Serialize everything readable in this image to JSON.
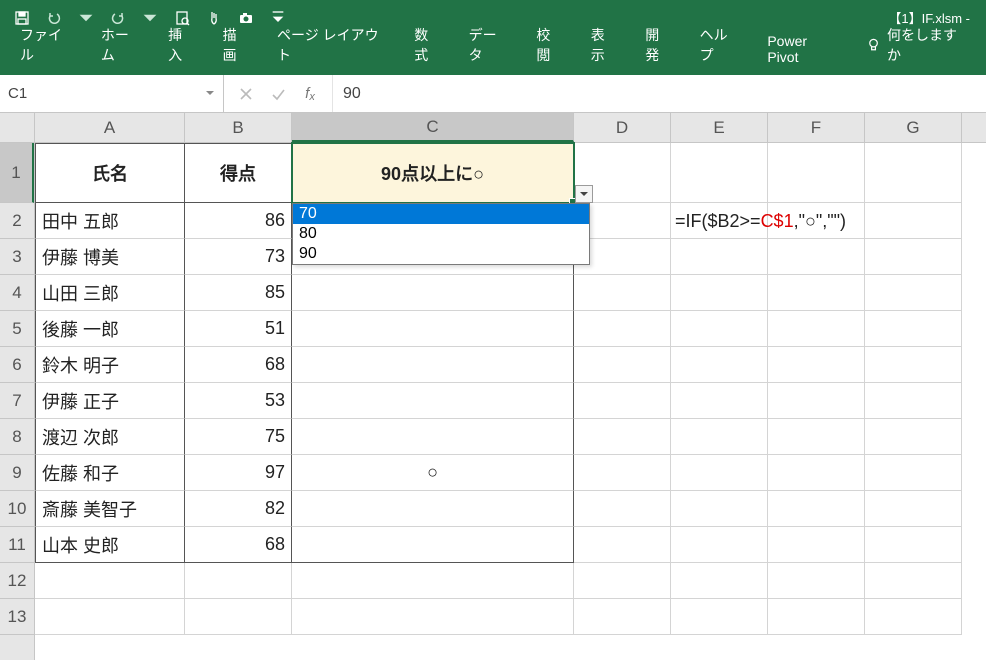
{
  "title": "【1】IF.xlsm  -",
  "tabs": [
    "ファイル",
    "ホーム",
    "挿入",
    "描画",
    "ページ レイアウト",
    "数式",
    "データ",
    "校閲",
    "表示",
    "開発",
    "ヘルプ",
    "Power Pivot"
  ],
  "tellMe": "何をしますか",
  "nameBox": "C1",
  "formulaBar": "90",
  "colHeaders": [
    "A",
    "B",
    "C",
    "D",
    "E",
    "F",
    "G"
  ],
  "rowHeaders": [
    "1",
    "2",
    "3",
    "4",
    "5",
    "6",
    "7",
    "8",
    "9",
    "10",
    "11",
    "12",
    "13"
  ],
  "headers": {
    "A": "氏名",
    "B": "得点",
    "C": "90点以上に○"
  },
  "rows": [
    {
      "name": "田中 五郎",
      "score": "86",
      "mark": ""
    },
    {
      "name": "伊藤 博美",
      "score": "73",
      "mark": ""
    },
    {
      "name": "山田 三郎",
      "score": "85",
      "mark": ""
    },
    {
      "name": "後藤 一郎",
      "score": "51",
      "mark": ""
    },
    {
      "name": "鈴木 明子",
      "score": "68",
      "mark": ""
    },
    {
      "name": "伊藤 正子",
      "score": "53",
      "mark": ""
    },
    {
      "name": "渡辺 次郎",
      "score": "75",
      "mark": ""
    },
    {
      "name": "佐藤 和子",
      "score": "97",
      "mark": "○"
    },
    {
      "name": "斎藤 美智子",
      "score": "82",
      "mark": ""
    },
    {
      "name": "山本 史郎",
      "score": "68",
      "mark": ""
    }
  ],
  "dropdown": {
    "options": [
      "70",
      "80",
      "90"
    ],
    "selectedIndex": 0
  },
  "formulaDisplay": {
    "p1": "=IF($B2>=",
    "ref": "C$1",
    "p2": ",\"○\",\"\")"
  },
  "chart_data": {
    "type": "table",
    "title": "",
    "columns": [
      "氏名",
      "得点",
      "90点以上に○"
    ],
    "rows": [
      [
        "田中 五郎",
        86,
        ""
      ],
      [
        "伊藤 博美",
        73,
        ""
      ],
      [
        "山田 三郎",
        85,
        ""
      ],
      [
        "後藤 一郎",
        51,
        ""
      ],
      [
        "鈴木 明子",
        68,
        ""
      ],
      [
        "伊藤 正子",
        53,
        ""
      ],
      [
        "渡辺 次郎",
        75,
        ""
      ],
      [
        "佐藤 和子",
        97,
        "○"
      ],
      [
        "斎藤 美智子",
        82,
        ""
      ],
      [
        "山本 史郎",
        68,
        ""
      ]
    ]
  }
}
